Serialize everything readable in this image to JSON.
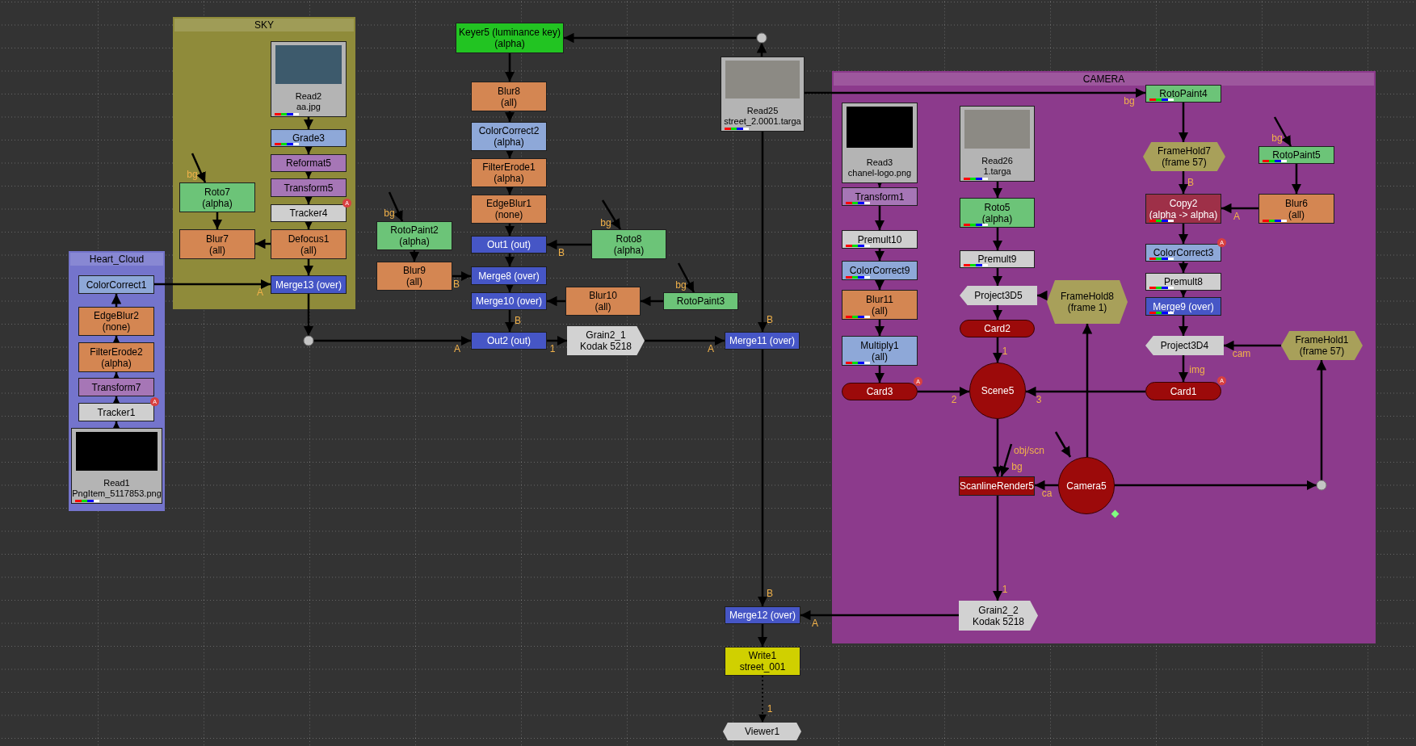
{
  "backdrops": [
    {
      "title": "SKY",
      "color": "#8f8b3a"
    },
    {
      "title": "Heart_Cloud",
      "color": "#7474cc"
    },
    {
      "title": "CAMERA",
      "color": "#8c3a8c"
    }
  ],
  "nodes": [
    {
      "kind": "read",
      "label": "Read2",
      "detail": "aa.jpg",
      "color": "#b4b4b4",
      "channels": true
    },
    {
      "kind": "box",
      "label": "Grade3",
      "color": "#8ea8d8",
      "channels": true
    },
    {
      "kind": "box",
      "label": "Reformat5",
      "color": "#a676b6",
      "channels": false
    },
    {
      "kind": "box",
      "label": "Transform5",
      "color": "#a676b6",
      "channels": false
    },
    {
      "kind": "box",
      "label": "Tracker4",
      "color": "#cfcfcf",
      "channels": false,
      "badge": "A"
    },
    {
      "kind": "box",
      "label": "Roto7",
      "detail": "(alpha)",
      "color": "#6cc478",
      "channels": false
    },
    {
      "kind": "box",
      "label": "Blur7",
      "detail": "(all)",
      "color": "#d48652",
      "channels": false
    },
    {
      "kind": "box",
      "label": "Defocus1",
      "detail": "(all)",
      "color": "#d48652",
      "channels": false
    },
    {
      "kind": "box",
      "label": "ColorCorrect1",
      "color": "#8ea8d8",
      "channels": false
    },
    {
      "kind": "box",
      "label": "Merge13 (over)",
      "color": "#4656c6",
      "channels": false
    },
    {
      "kind": "box",
      "label": "EdgeBlur2",
      "detail": "(none)",
      "color": "#d48652",
      "channels": false
    },
    {
      "kind": "box",
      "label": "FilterErode2",
      "detail": "(alpha)",
      "color": "#d48652",
      "channels": false
    },
    {
      "kind": "box",
      "label": "Transform7",
      "color": "#a676b6",
      "channels": false
    },
    {
      "kind": "box",
      "label": "Tracker1",
      "color": "#cfcfcf",
      "channels": false,
      "badge": "A"
    },
    {
      "kind": "read",
      "label": "Read1",
      "detail": "PngItem_5117853.png",
      "color": "#b4b4b4",
      "channels": true
    },
    {
      "kind": "box",
      "label": "RotoPaint2",
      "detail": "(alpha)",
      "color": "#6cc478",
      "channels": false
    },
    {
      "kind": "box",
      "label": "Blur9",
      "detail": "(all)",
      "color": "#d48652",
      "channels": false
    },
    {
      "kind": "box",
      "label": "Keyer5 (luminance key)",
      "detail": "(alpha)",
      "color": "#22c422",
      "channels": false
    },
    {
      "kind": "box",
      "label": "Blur8",
      "detail": "(all)",
      "color": "#d48652",
      "channels": false
    },
    {
      "kind": "box",
      "label": "ColorCorrect2",
      "detail": "(alpha)",
      "color": "#8ea8d8",
      "channels": false
    },
    {
      "kind": "box",
      "label": "FilterErode1",
      "detail": "(alpha)",
      "color": "#d48652",
      "channels": false
    },
    {
      "kind": "box",
      "label": "EdgeBlur1",
      "detail": "(none)",
      "color": "#d48652",
      "channels": false
    },
    {
      "kind": "box",
      "label": "Out1 (out)",
      "color": "#4656c6",
      "channels": false
    },
    {
      "kind": "box",
      "label": "Merge8 (over)",
      "color": "#4656c6",
      "channels": false
    },
    {
      "kind": "box",
      "label": "Merge10 (over)",
      "color": "#4656c6",
      "channels": false
    },
    {
      "kind": "box",
      "label": "Out2 (out)",
      "color": "#4656c6",
      "channels": false
    },
    {
      "kind": "box",
      "label": "Roto8",
      "detail": "(alpha)",
      "color": "#6cc478",
      "channels": false
    },
    {
      "kind": "box",
      "label": "Blur10",
      "detail": "(all)",
      "color": "#d48652",
      "channels": false
    },
    {
      "kind": "box",
      "label": "RotoPaint3",
      "color": "#6cc478",
      "channels": false
    },
    {
      "kind": "tag_right",
      "label": "Grain2_1",
      "detail": "Kodak 5218",
      "color": "#d2d2d2",
      "channels": false
    },
    {
      "kind": "read",
      "label": "Read25",
      "detail": "street_2.0001.targa",
      "color": "#b4b4b4",
      "channels": true
    },
    {
      "kind": "box",
      "label": "Merge11 (over)",
      "color": "#4656c6",
      "channels": false
    },
    {
      "kind": "box",
      "label": "Merge12 (over)",
      "color": "#4656c6",
      "channels": false
    },
    {
      "kind": "box",
      "label": "Write1",
      "detail": "street_001",
      "color": "#d0d000",
      "channels": false
    },
    {
      "kind": "tag_both",
      "label": "Viewer1",
      "color": "#cfcfcf",
      "channels": false
    },
    {
      "kind": "read",
      "label": "Read3",
      "detail": "chanel-logo.png",
      "color": "#b4b4b4",
      "channels": false
    },
    {
      "kind": "box",
      "label": "Transform1",
      "color": "#a676b6",
      "channels": true
    },
    {
      "kind": "box",
      "label": "Premult10",
      "color": "#cfcfcf",
      "channels": true
    },
    {
      "kind": "box",
      "label": "ColorCorrect9",
      "color": "#8ea8d8",
      "channels": true
    },
    {
      "kind": "box",
      "label": "Blur11",
      "detail": "(all)",
      "color": "#d48652",
      "channels": true
    },
    {
      "kind": "box",
      "label": "Multiply1",
      "detail": "(all)",
      "color": "#8ea8d8",
      "channels": true
    },
    {
      "kind": "pill",
      "label": "Card3",
      "color": "#9c0a0a",
      "channels": false,
      "badge": "A"
    },
    {
      "kind": "read",
      "label": "Read26",
      "detail": "1.targa",
      "color": "#b4b4b4",
      "channels": true
    },
    {
      "kind": "box",
      "label": "Roto5",
      "detail": "(alpha)",
      "color": "#6cc478",
      "channels": true
    },
    {
      "kind": "box",
      "label": "Premult9",
      "color": "#cfcfcf",
      "channels": true
    },
    {
      "kind": "tag_left",
      "label": "Project3D5",
      "color": "#cfcfcf",
      "channels": false
    },
    {
      "kind": "pill",
      "label": "Card2",
      "color": "#9c0a0a",
      "channels": false
    },
    {
      "kind": "circle",
      "label": "Scene5",
      "color": "#9c0a0a",
      "channels": false
    },
    {
      "kind": "hex",
      "label": "FrameHold8",
      "detail": "(frame 1)",
      "color": "#a8a05a",
      "channels": false
    },
    {
      "kind": "box",
      "label": "RotoPaint4",
      "color": "#6cc478",
      "channels": true
    },
    {
      "kind": "hex",
      "label": "FrameHold7",
      "detail": "(frame 57)",
      "color": "#a8a05a",
      "channels": false
    },
    {
      "kind": "box",
      "label": "Copy2",
      "detail": "(alpha -> alpha)",
      "color": "#9e3048",
      "channels": true
    },
    {
      "kind": "box",
      "label": "ColorCorrect3",
      "color": "#8ea8d8",
      "channels": true,
      "badge": "A"
    },
    {
      "kind": "box",
      "label": "Premult8",
      "color": "#cfcfcf",
      "channels": true
    },
    {
      "kind": "box",
      "label": "Merge9 (over)",
      "color": "#4656c6",
      "channels": true
    },
    {
      "kind": "tag_left",
      "label": "Project3D4",
      "color": "#cfcfcf",
      "channels": false
    },
    {
      "kind": "pill",
      "label": "Card1",
      "color": "#9c0a0a",
      "channels": false,
      "badge": "A"
    },
    {
      "kind": "box",
      "label": "RotoPaint5",
      "color": "#6cc478",
      "channels": true
    },
    {
      "kind": "box",
      "label": "Blur6",
      "detail": "(all)",
      "color": "#d48652",
      "channels": true
    },
    {
      "kind": "hex",
      "label": "FrameHold1",
      "detail": "(frame 57)",
      "color": "#a8a05a",
      "channels": false
    },
    {
      "kind": "box",
      "label": "ScanlineRender5",
      "color": "#9c0a0a",
      "channels": false
    },
    {
      "kind": "circle",
      "label": "Camera5",
      "color": "#9c0a0a",
      "channels": false
    },
    {
      "kind": "tag_right",
      "label": "Grain2_2",
      "detail": "Kodak 5218",
      "color": "#d2d2d2",
      "channels": false
    }
  ],
  "edge_labels": [
    "A",
    "A",
    "bg",
    "bg",
    "B",
    "B",
    "B",
    "bg",
    "bg",
    "1",
    "A",
    "B",
    "B",
    "1",
    "A",
    "bg",
    "2",
    "1",
    "3",
    "B",
    "bg",
    "A",
    "img",
    "cam",
    "obj/scn",
    "bg",
    "ca",
    "1"
  ]
}
